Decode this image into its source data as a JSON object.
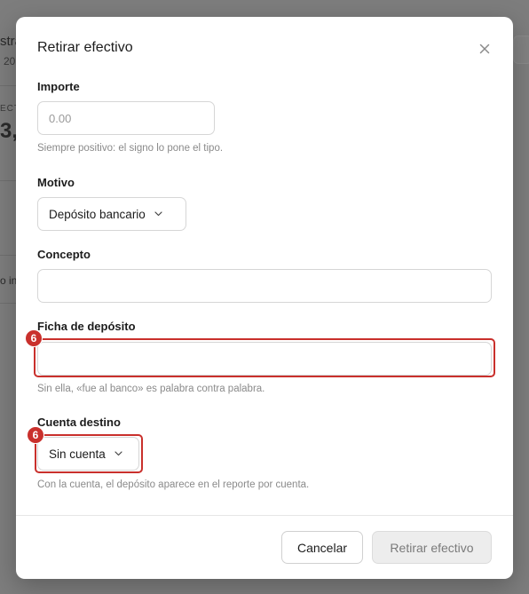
{
  "background": {
    "fragments": [
      "stra",
      "20",
      "ECT",
      "3,",
      "o ina"
    ]
  },
  "modal": {
    "title": "Retirar efectivo",
    "close_icon": "close-icon",
    "fields": {
      "importe": {
        "label": "Importe",
        "placeholder": "0.00",
        "value": "",
        "hint": "Siempre positivo: el signo lo pone el tipo."
      },
      "motivo": {
        "label": "Motivo",
        "selected": "Depósito bancario"
      },
      "concepto": {
        "label": "Concepto",
        "value": ""
      },
      "ficha": {
        "label": "Ficha de depósito",
        "value": "",
        "hint": "Sin ella, «fue al banco» es palabra contra palabra.",
        "badge": "6"
      },
      "cuenta": {
        "label": "Cuenta destino",
        "selected": "Sin cuenta",
        "hint": "Con la cuenta, el depósito aparece en el reporte por cuenta.",
        "badge": "6"
      }
    },
    "buttons": {
      "cancel": "Cancelar",
      "submit": "Retirar efectivo"
    }
  },
  "colors": {
    "highlight": "#c9302c",
    "overlay": "#7d7d7d"
  }
}
